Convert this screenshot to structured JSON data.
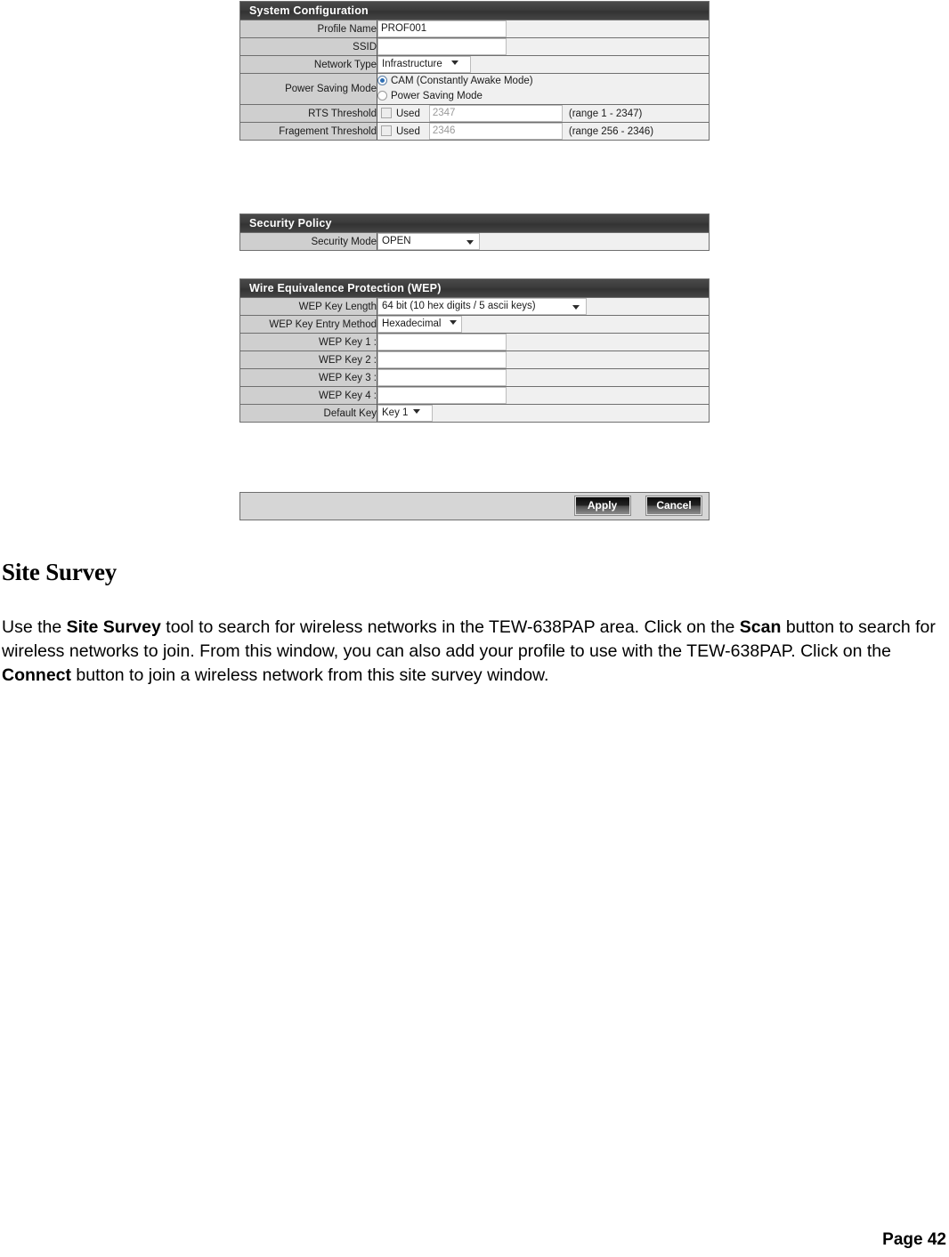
{
  "system_configuration": {
    "header": "System Configuration",
    "rows": {
      "profile_name": {
        "label": "Profile Name",
        "value": "PROF001"
      },
      "ssid": {
        "label": "SSID",
        "value": ""
      },
      "network_type": {
        "label": "Network Type",
        "value": "Infrastructure"
      },
      "power_saving_mode": {
        "label": "Power Saving Mode",
        "option_cam": "CAM (Constantly Awake Mode)",
        "option_psm": "Power Saving Mode",
        "selected": "CAM (Constantly Awake Mode)"
      },
      "rts_threshold": {
        "label": "RTS Threshold",
        "used_label": "Used",
        "checked": false,
        "value": "2347",
        "range": "(range 1 - 2347)"
      },
      "fragment_threshold": {
        "label": "Fragement Threshold",
        "used_label": "Used",
        "checked": false,
        "value": "2346",
        "range": "(range 256 - 2346)"
      }
    }
  },
  "security_policy": {
    "header": "Security Policy",
    "security_mode": {
      "label": "Security Mode",
      "value": "OPEN"
    }
  },
  "wep": {
    "header": "Wire Equivalence Protection (WEP)",
    "key_length": {
      "label": "WEP Key Length",
      "value": "64 bit (10 hex digits / 5 ascii keys)"
    },
    "key_entry_method": {
      "label": "WEP Key Entry Method",
      "value": "Hexadecimal"
    },
    "keys": [
      {
        "label": "WEP Key 1 :",
        "value": ""
      },
      {
        "label": "WEP Key 2 :",
        "value": ""
      },
      {
        "label": "WEP Key 3 :",
        "value": ""
      },
      {
        "label": "WEP Key 4 :",
        "value": ""
      }
    ],
    "default_key": {
      "label": "Default Key",
      "value": "Key 1"
    }
  },
  "buttons": {
    "apply": "Apply",
    "cancel": "Cancel"
  },
  "document": {
    "heading": "Site Survey",
    "paragraph": {
      "s1": "Use the ",
      "b1": "Site Survey",
      "s2": " tool to search for wireless networks in the TEW-638PAP area. Click on the ",
      "b2": "Scan",
      "s3": " button to search for wireless networks to join. From this window, you can also add your profile to use with the TEW-638PAP. Click on the ",
      "b3": "Connect",
      "s4": " button to join a wireless network from this site survey window."
    },
    "page_footer": "Page  42"
  }
}
